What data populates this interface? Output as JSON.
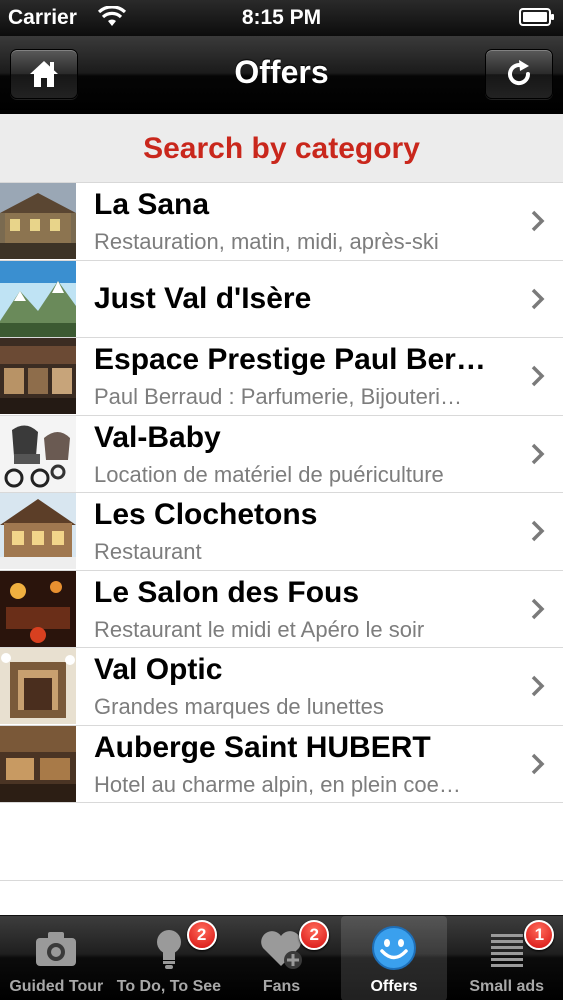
{
  "status_bar": {
    "carrier": "Carrier",
    "time": "8:15 PM"
  },
  "nav": {
    "title": "Offers",
    "left_icon": "home-icon",
    "right_icon": "refresh-icon"
  },
  "category_header": "Search by category",
  "offers": [
    {
      "title": "La Sana",
      "subtitle": "Restauration, matin, midi, après-ski"
    },
    {
      "title": "Just Val d'Isère",
      "subtitle": ""
    },
    {
      "title": "Espace Prestige Paul Ber…",
      "subtitle": "Paul Berraud : Parfumerie, Bijouteri…"
    },
    {
      "title": "Val-Baby",
      "subtitle": "Location de matériel de puériculture"
    },
    {
      "title": "Les Clochetons",
      "subtitle": "Restaurant"
    },
    {
      "title": "Le Salon des Fous",
      "subtitle": "Restaurant le midi et Apéro le soir"
    },
    {
      "title": "Val Optic",
      "subtitle": "Grandes marques de lunettes"
    },
    {
      "title": "Auberge Saint HUBERT",
      "subtitle": "Hotel au charme alpin, en plein coe…"
    }
  ],
  "tabs": [
    {
      "label": "Guided Tour",
      "icon": "camera-icon",
      "badge": ""
    },
    {
      "label": "To Do, To See",
      "icon": "lightbulb-icon",
      "badge": "2"
    },
    {
      "label": "Fans",
      "icon": "heart-plus-icon",
      "badge": "2"
    },
    {
      "label": "Offers",
      "icon": "smiley-icon",
      "badge": "",
      "selected": true
    },
    {
      "label": "Small ads",
      "icon": "list-icon",
      "badge": "1"
    }
  ],
  "colors": {
    "accent_red": "#c9271c",
    "badge_red": "#d50f0f",
    "selected_tab_icon": "#3aa0ee"
  }
}
